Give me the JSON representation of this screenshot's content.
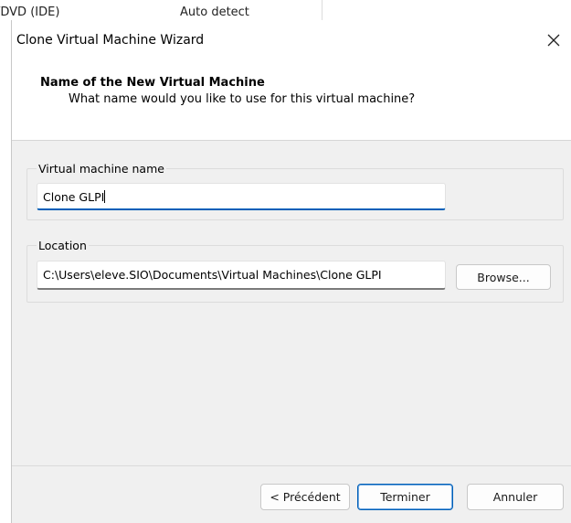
{
  "background": {
    "col1_text": "/DVD (IDE)",
    "col2_text": "Auto detect"
  },
  "dialog": {
    "title": "Clone Virtual Machine Wizard",
    "close_icon": "close-icon"
  },
  "header": {
    "title": "Name of the New Virtual Machine",
    "subtitle": "What name would you like to use for this virtual machine?"
  },
  "name_group": {
    "legend": "Virtual machine name",
    "value": "Clone GLPI"
  },
  "location_group": {
    "legend": "Location",
    "value": "C:\\Users\\eleve.SIO\\Documents\\Virtual Machines\\Clone GLPI",
    "browse_label": "Browse..."
  },
  "footer": {
    "back_label": "< Précédent",
    "finish_label": "Terminer",
    "cancel_label": "Annuler"
  },
  "colors": {
    "accent": "#005fb8",
    "dialog_bg": "#f0f0f0"
  }
}
